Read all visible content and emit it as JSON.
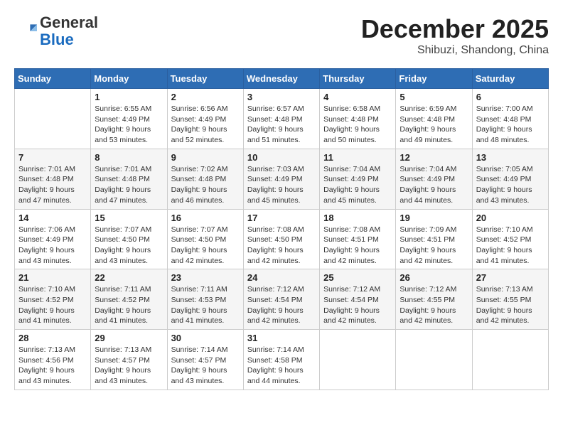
{
  "logo": {
    "general": "General",
    "blue": "Blue"
  },
  "header": {
    "month_year": "December 2025",
    "location": "Shibuzi, Shandong, China"
  },
  "weekdays": [
    "Sunday",
    "Monday",
    "Tuesday",
    "Wednesday",
    "Thursday",
    "Friday",
    "Saturday"
  ],
  "weeks": [
    [
      {
        "day": "",
        "sunrise": "",
        "sunset": "",
        "daylight": ""
      },
      {
        "day": "1",
        "sunrise": "Sunrise: 6:55 AM",
        "sunset": "Sunset: 4:49 PM",
        "daylight": "Daylight: 9 hours and 53 minutes."
      },
      {
        "day": "2",
        "sunrise": "Sunrise: 6:56 AM",
        "sunset": "Sunset: 4:49 PM",
        "daylight": "Daylight: 9 hours and 52 minutes."
      },
      {
        "day": "3",
        "sunrise": "Sunrise: 6:57 AM",
        "sunset": "Sunset: 4:48 PM",
        "daylight": "Daylight: 9 hours and 51 minutes."
      },
      {
        "day": "4",
        "sunrise": "Sunrise: 6:58 AM",
        "sunset": "Sunset: 4:48 PM",
        "daylight": "Daylight: 9 hours and 50 minutes."
      },
      {
        "day": "5",
        "sunrise": "Sunrise: 6:59 AM",
        "sunset": "Sunset: 4:48 PM",
        "daylight": "Daylight: 9 hours and 49 minutes."
      },
      {
        "day": "6",
        "sunrise": "Sunrise: 7:00 AM",
        "sunset": "Sunset: 4:48 PM",
        "daylight": "Daylight: 9 hours and 48 minutes."
      }
    ],
    [
      {
        "day": "7",
        "sunrise": "Sunrise: 7:01 AM",
        "sunset": "Sunset: 4:48 PM",
        "daylight": "Daylight: 9 hours and 47 minutes."
      },
      {
        "day": "8",
        "sunrise": "Sunrise: 7:01 AM",
        "sunset": "Sunset: 4:48 PM",
        "daylight": "Daylight: 9 hours and 47 minutes."
      },
      {
        "day": "9",
        "sunrise": "Sunrise: 7:02 AM",
        "sunset": "Sunset: 4:48 PM",
        "daylight": "Daylight: 9 hours and 46 minutes."
      },
      {
        "day": "10",
        "sunrise": "Sunrise: 7:03 AM",
        "sunset": "Sunset: 4:49 PM",
        "daylight": "Daylight: 9 hours and 45 minutes."
      },
      {
        "day": "11",
        "sunrise": "Sunrise: 7:04 AM",
        "sunset": "Sunset: 4:49 PM",
        "daylight": "Daylight: 9 hours and 45 minutes."
      },
      {
        "day": "12",
        "sunrise": "Sunrise: 7:04 AM",
        "sunset": "Sunset: 4:49 PM",
        "daylight": "Daylight: 9 hours and 44 minutes."
      },
      {
        "day": "13",
        "sunrise": "Sunrise: 7:05 AM",
        "sunset": "Sunset: 4:49 PM",
        "daylight": "Daylight: 9 hours and 43 minutes."
      }
    ],
    [
      {
        "day": "14",
        "sunrise": "Sunrise: 7:06 AM",
        "sunset": "Sunset: 4:49 PM",
        "daylight": "Daylight: 9 hours and 43 minutes."
      },
      {
        "day": "15",
        "sunrise": "Sunrise: 7:07 AM",
        "sunset": "Sunset: 4:50 PM",
        "daylight": "Daylight: 9 hours and 43 minutes."
      },
      {
        "day": "16",
        "sunrise": "Sunrise: 7:07 AM",
        "sunset": "Sunset: 4:50 PM",
        "daylight": "Daylight: 9 hours and 42 minutes."
      },
      {
        "day": "17",
        "sunrise": "Sunrise: 7:08 AM",
        "sunset": "Sunset: 4:50 PM",
        "daylight": "Daylight: 9 hours and 42 minutes."
      },
      {
        "day": "18",
        "sunrise": "Sunrise: 7:08 AM",
        "sunset": "Sunset: 4:51 PM",
        "daylight": "Daylight: 9 hours and 42 minutes."
      },
      {
        "day": "19",
        "sunrise": "Sunrise: 7:09 AM",
        "sunset": "Sunset: 4:51 PM",
        "daylight": "Daylight: 9 hours and 42 minutes."
      },
      {
        "day": "20",
        "sunrise": "Sunrise: 7:10 AM",
        "sunset": "Sunset: 4:52 PM",
        "daylight": "Daylight: 9 hours and 41 minutes."
      }
    ],
    [
      {
        "day": "21",
        "sunrise": "Sunrise: 7:10 AM",
        "sunset": "Sunset: 4:52 PM",
        "daylight": "Daylight: 9 hours and 41 minutes."
      },
      {
        "day": "22",
        "sunrise": "Sunrise: 7:11 AM",
        "sunset": "Sunset: 4:52 PM",
        "daylight": "Daylight: 9 hours and 41 minutes."
      },
      {
        "day": "23",
        "sunrise": "Sunrise: 7:11 AM",
        "sunset": "Sunset: 4:53 PM",
        "daylight": "Daylight: 9 hours and 41 minutes."
      },
      {
        "day": "24",
        "sunrise": "Sunrise: 7:12 AM",
        "sunset": "Sunset: 4:54 PM",
        "daylight": "Daylight: 9 hours and 42 minutes."
      },
      {
        "day": "25",
        "sunrise": "Sunrise: 7:12 AM",
        "sunset": "Sunset: 4:54 PM",
        "daylight": "Daylight: 9 hours and 42 minutes."
      },
      {
        "day": "26",
        "sunrise": "Sunrise: 7:12 AM",
        "sunset": "Sunset: 4:55 PM",
        "daylight": "Daylight: 9 hours and 42 minutes."
      },
      {
        "day": "27",
        "sunrise": "Sunrise: 7:13 AM",
        "sunset": "Sunset: 4:55 PM",
        "daylight": "Daylight: 9 hours and 42 minutes."
      }
    ],
    [
      {
        "day": "28",
        "sunrise": "Sunrise: 7:13 AM",
        "sunset": "Sunset: 4:56 PM",
        "daylight": "Daylight: 9 hours and 43 minutes."
      },
      {
        "day": "29",
        "sunrise": "Sunrise: 7:13 AM",
        "sunset": "Sunset: 4:57 PM",
        "daylight": "Daylight: 9 hours and 43 minutes."
      },
      {
        "day": "30",
        "sunrise": "Sunrise: 7:14 AM",
        "sunset": "Sunset: 4:57 PM",
        "daylight": "Daylight: 9 hours and 43 minutes."
      },
      {
        "day": "31",
        "sunrise": "Sunrise: 7:14 AM",
        "sunset": "Sunset: 4:58 PM",
        "daylight": "Daylight: 9 hours and 44 minutes."
      },
      {
        "day": "",
        "sunrise": "",
        "sunset": "",
        "daylight": ""
      },
      {
        "day": "",
        "sunrise": "",
        "sunset": "",
        "daylight": ""
      },
      {
        "day": "",
        "sunrise": "",
        "sunset": "",
        "daylight": ""
      }
    ]
  ]
}
